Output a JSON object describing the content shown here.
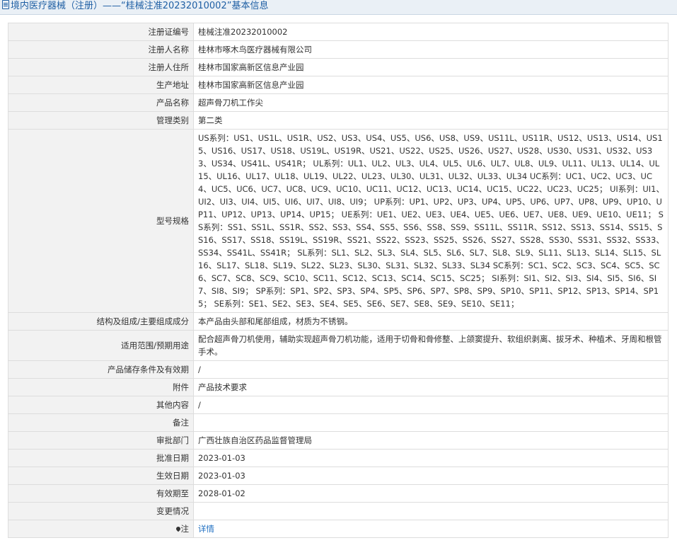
{
  "header": {
    "title": "境内医疗器械（注册）——“桂械注准20232010002”基本信息"
  },
  "rows": [
    {
      "label": "注册证编号",
      "value": "桂械注准20232010002"
    },
    {
      "label": "注册人名称",
      "value": "桂林市啄木鸟医疗器械有限公司"
    },
    {
      "label": "注册人住所",
      "value": "桂林市国家高新区信息产业园"
    },
    {
      "label": "生产地址",
      "value": "桂林市国家高新区信息产业园"
    },
    {
      "label": "产品名称",
      "value": "超声骨刀机工作尖"
    },
    {
      "label": "管理类别",
      "value": "第二类"
    },
    {
      "label": "型号规格",
      "value": "US系列：US1、US1L、US1R、US2、US3、US4、US5、US6、US8、US9、US11L、US11R、US12、US13、US14、US15、US16、US17、US18、US19L、US19R、US21、US22、US25、US26、US27、US28、US30、US31、US32、US33、US34、US41L、US41R； UL系列：UL1、UL2、UL3、UL4、UL5、UL6、UL7、UL8、UL9、UL11、UL13、UL14、UL15、UL16、UL17、UL18、UL19、UL22、UL23、UL30、UL31、UL32、UL33、UL34 UC系列：UC1、UC2、UC3、UC4、UC5、UC6、UC7、UC8、UC9、UC10、UC11、UC12、UC13、UC14、UC15、UC22、UC23、UC25； UI系列：UI1、UI2、UI3、UI4、UI5、UI6、UI7、UI8、UI9； UP系列：UP1、UP2、UP3、UP4、UP5、UP6、UP7、UP8、UP9、UP10、UP11、UP12、UP13、UP14、UP15； UE系列：UE1、UE2、UE3、UE4、UE5、UE6、UE7、UE8、UE9、UE10、UE11； SS系列：SS1、SS1L、SS1R、SS2、SS3、SS4、SS5、SS6、SS8、SS9、SS11L、SS11R、SS12、SS13、SS14、SS15、SS16、SS17、SS18、SS19L、SS19R、SS21、SS22、SS23、SS25、SS26、SS27、SS28、SS30、SS31、SS32、SS33、SS34、SS41L、SS41R； SL系列：SL1、SL2、SL3、SL4、SL5、SL6、SL7、SL8、SL9、SL11、SL13、SL14、SL15、SL16、SL17、SL18、SL19、SL22、SL23、SL30、SL31、SL32、SL33、SL34 SC系列：SC1、SC2、SC3、SC4、SC5、SC6、SC7、SC8、SC9、SC10、SC11、SC12、SC13、SC14、SC15、SC25； SI系列：SI1、SI2、SI3、SI4、SI5、SI6、SI7、SI8、SI9； SP系列：SP1、SP2、SP3、SP4、SP5、SP6、SP7、SP8、SP9、SP10、SP11、SP12、SP13、SP14、SP15； SE系列：SE1、SE2、SE3、SE4、SE5、SE6、SE7、SE8、SE9、SE10、SE11；"
    },
    {
      "label": "结构及组成/主要组成成分",
      "value": "本产品由头部和尾部组成，材质为不锈钢。"
    },
    {
      "label": "适用范围/预期用途",
      "value": "配合超声骨刀机使用，辅助实现超声骨刀机功能，适用于切骨和骨修整、上颌窦提升、软组织剥离、拔牙术、种植术、牙周和根管手术。"
    },
    {
      "label": "产品储存条件及有效期",
      "value": "/"
    },
    {
      "label": "附件",
      "value": "产品技术要求"
    },
    {
      "label": "其他内容",
      "value": "/"
    },
    {
      "label": "备注",
      "value": ""
    },
    {
      "label": "审批部门",
      "value": "广西壮族自治区药品监督管理局"
    },
    {
      "label": "批准日期",
      "value": "2023-01-03"
    },
    {
      "label": "生效日期",
      "value": "2023-01-03"
    },
    {
      "label": "有效期至",
      "value": "2028-01-02"
    },
    {
      "label": "变更情况",
      "value": ""
    }
  ],
  "note_row": {
    "label": "注",
    "link_text": "详情",
    "icon": "pin-icon"
  }
}
